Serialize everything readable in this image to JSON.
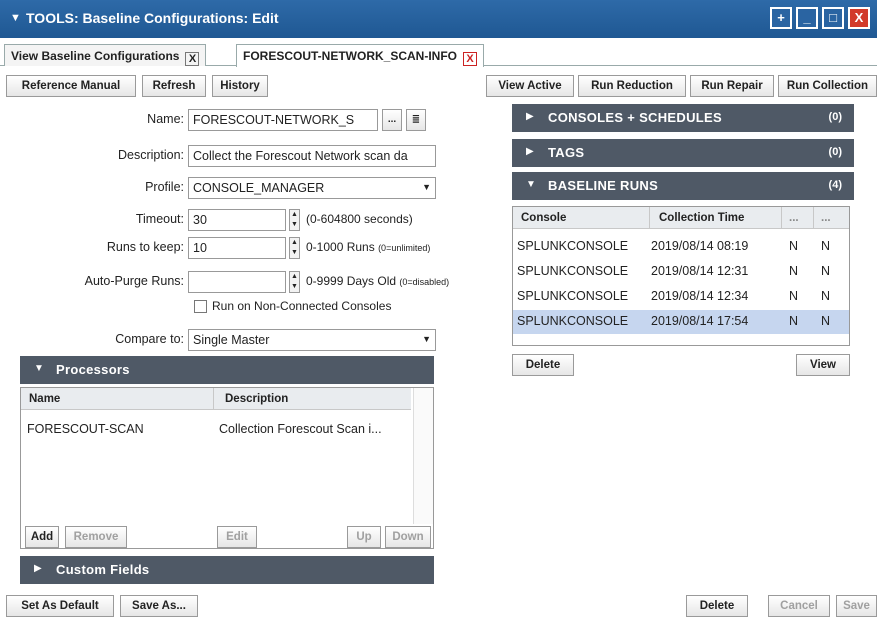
{
  "window": {
    "title": "TOOLS: Baseline Configurations: Edit",
    "controls": [
      "+",
      "_",
      "□",
      "X"
    ]
  },
  "tabs": [
    {
      "label": "View Baseline Configurations",
      "close": "X"
    },
    {
      "label": "FORESCOUT-NETWORK_SCAN-INFO",
      "close": "X"
    }
  ],
  "toolbar": {
    "reference_manual": "Reference Manual",
    "refresh": "Refresh",
    "history": "History",
    "view_active": "View Active",
    "run_reduction": "Run Reduction",
    "run_repair": "Run Repair",
    "run_collection": "Run Collection"
  },
  "form": {
    "name_label": "Name:",
    "name_value": "FORESCOUT-NETWORK_S",
    "name_more": "...",
    "description_label": "Description:",
    "description_value": "Collect the Forescout Network scan da",
    "profile_label": "Profile:",
    "profile_value": "CONSOLE_MANAGER",
    "timeout_label": "Timeout:",
    "timeout_value": "30",
    "timeout_hint": "(0-604800 seconds)",
    "runs_label": "Runs to keep:",
    "runs_value": "10",
    "runs_hint": "0-1000 Runs",
    "runs_hint_small": "(0=unlimited)",
    "autopurge_label": "Auto-Purge Runs:",
    "autopurge_value": "",
    "autopurge_hint": "0-9999 Days Old",
    "autopurge_hint_small": "(0=disabled)",
    "nonconnected_label": "Run on Non-Connected Consoles",
    "nonconnected_checked": false,
    "compare_label": "Compare to:",
    "compare_value": "Single Master"
  },
  "processors": {
    "title": "Processors",
    "columns": [
      "Name",
      "Description"
    ],
    "rows": [
      {
        "name": "FORESCOUT-SCAN",
        "description": "Collection Forescout Scan i..."
      }
    ],
    "buttons": {
      "add": "Add",
      "remove": "Remove",
      "edit": "Edit",
      "up": "Up",
      "down": "Down"
    }
  },
  "custom_fields": {
    "title": "Custom Fields"
  },
  "bottom": {
    "set_default": "Set As Default",
    "save_as": "Save As...",
    "delete": "Delete",
    "cancel": "Cancel",
    "save": "Save"
  },
  "right": {
    "consoles": {
      "title": "CONSOLES + SCHEDULES",
      "count": "(0)"
    },
    "tags": {
      "title": "TAGS",
      "count": "(0)"
    },
    "runs": {
      "title": "BASELINE RUNS",
      "count": "(4)",
      "columns": [
        "Console",
        "Collection Time",
        "...",
        "..."
      ],
      "rows": [
        {
          "console": "SPLUNKCONSOLE",
          "time": "2019/08/14 08:19",
          "c3": "N",
          "c4": "N",
          "selected": false
        },
        {
          "console": "SPLUNKCONSOLE",
          "time": "2019/08/14 12:31",
          "c3": "N",
          "c4": "N",
          "selected": false
        },
        {
          "console": "SPLUNKCONSOLE",
          "time": "2019/08/14 12:34",
          "c3": "N",
          "c4": "N",
          "selected": false
        },
        {
          "console": "SPLUNKCONSOLE",
          "time": "2019/08/14 17:54",
          "c3": "N",
          "c4": "N",
          "selected": true
        }
      ],
      "delete": "Delete",
      "view": "View"
    }
  }
}
